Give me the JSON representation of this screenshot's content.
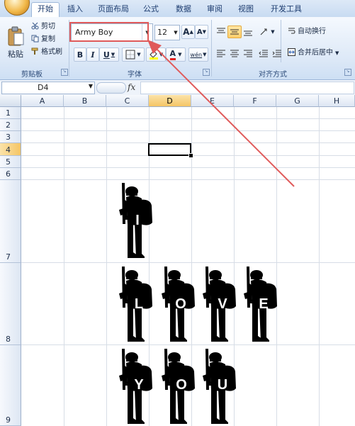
{
  "tabs": [
    "开始",
    "插入",
    "页面布局",
    "公式",
    "数据",
    "审阅",
    "视图",
    "开发工具"
  ],
  "clipboard": {
    "paste": "粘贴",
    "cut": "剪切",
    "copy": "复制",
    "format_painter": "格式刷",
    "group": "剪贴板"
  },
  "font": {
    "name": "Army Boy",
    "size": "12",
    "grow": "A",
    "shrink": "A",
    "bold": "B",
    "italic": "I",
    "underline": "U",
    "font_color": "A",
    "wen": "wén",
    "group": "字体"
  },
  "alignment": {
    "wrap": "自动换行",
    "merge": "合并后居中",
    "group": "对齐方式"
  },
  "formula_bar": {
    "name_box": "D4",
    "fx": "fx",
    "content": ""
  },
  "columns": [
    "A",
    "B",
    "C",
    "D",
    "E",
    "F",
    "G",
    "H"
  ],
  "rows": [
    "1",
    "2",
    "3",
    "4",
    "5",
    "6",
    "7",
    "8",
    "9"
  ],
  "active_cell": "D4",
  "art": {
    "row7": [
      "I"
    ],
    "row8": [
      "L",
      "O",
      "V",
      "E"
    ],
    "row9": [
      "Y",
      "O",
      "U"
    ]
  },
  "colors": {
    "annotation": "#e05a5a",
    "accent": "#f5c565"
  }
}
